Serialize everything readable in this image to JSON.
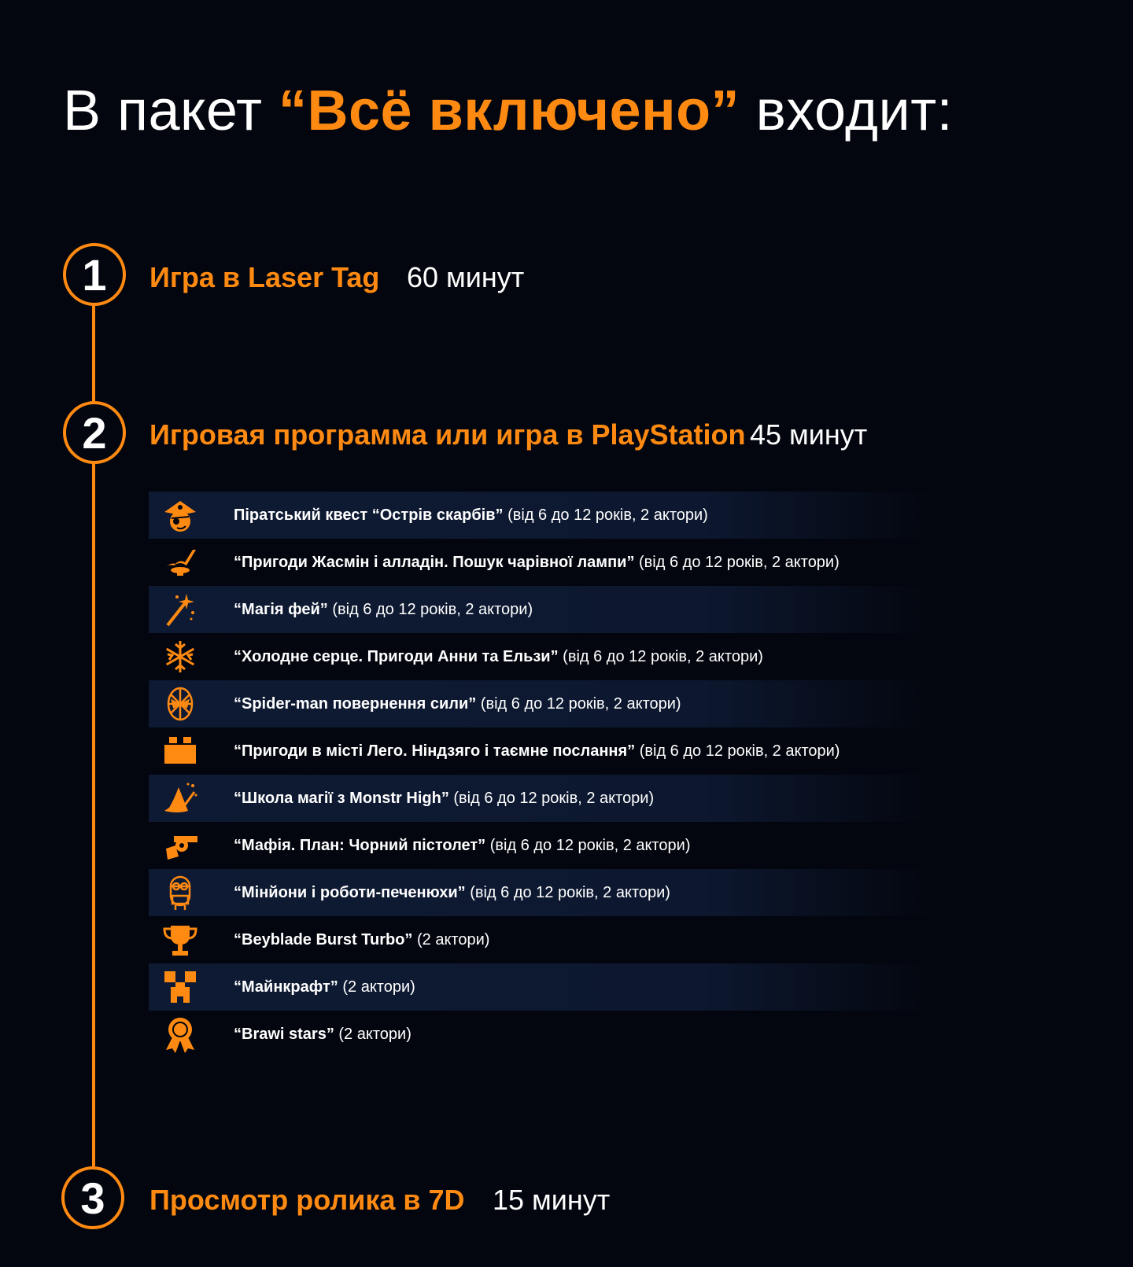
{
  "header": {
    "title_prefix": "В пакет ",
    "title_accent": "“Всё включено”",
    "title_suffix": " входит:"
  },
  "steps": [
    {
      "number": "1",
      "title": "Игра в Laser Tag",
      "duration": "60 минут"
    },
    {
      "number": "2",
      "title": "Игровая программа или игра в PlayStation",
      "duration": "45 минут"
    },
    {
      "number": "3",
      "title": "Просмотр ролика в 7D",
      "duration": "15 минут"
    }
  ],
  "programs": [
    {
      "icon": "pirate-icon",
      "name": "Піратський квест “Острів скарбів”",
      "detail": " (від 6 до 12 років, 2 актори)"
    },
    {
      "icon": "magic-lamp-icon",
      "name": "“Пригоди Жасмін і алладін. Пошук чарівної лампи”",
      "detail": " (від 6 до 12 років, 2 актори)"
    },
    {
      "icon": "magic-wand-icon",
      "name": "“Магія фей”",
      "detail": " (від 6 до 12 років, 2 актори)"
    },
    {
      "icon": "snowflake-icon",
      "name": "“Холодне серце. Пригоди Анни та Ельзи”",
      "detail": " (від 6 до 12 років, 2 актори)"
    },
    {
      "icon": "spider-man-icon",
      "name": "“Spider-man повернення сили”",
      "detail": " (від 6 до 12 років, 2 актори)"
    },
    {
      "icon": "lego-brick-icon",
      "name": "“Пригоди в місті Лего. Ніндзяго і таємне послання”",
      "detail": " (від 6 до 12 років, 2 актори)"
    },
    {
      "icon": "witch-hat-icon",
      "name": "“Школа магії з Monstr High”",
      "detail": " (від 6 до 12 років, 2 актори)"
    },
    {
      "icon": "revolver-icon",
      "name": "“Мафія. План: Чорний пістолет”",
      "detail": " (від 6 до 12 років, 2 актори)"
    },
    {
      "icon": "minion-icon",
      "name": "“Мінйони і роботи-печенюхи”",
      "detail": " (від 6 до 12 років, 2 актори)"
    },
    {
      "icon": "trophy-icon",
      "name": "“Beyblade Burst Turbo”",
      "detail": " (2 актори)"
    },
    {
      "icon": "creeper-icon",
      "name": "“Майнкрафт”",
      "detail": " (2 актори)"
    },
    {
      "icon": "award-ribbon-icon",
      "name": "“Brawi stars”",
      "detail": " (2 актори)"
    }
  ],
  "colors": {
    "accent": "#ff8a12",
    "background": "#03060e",
    "row_shade": "#0e1a33"
  }
}
